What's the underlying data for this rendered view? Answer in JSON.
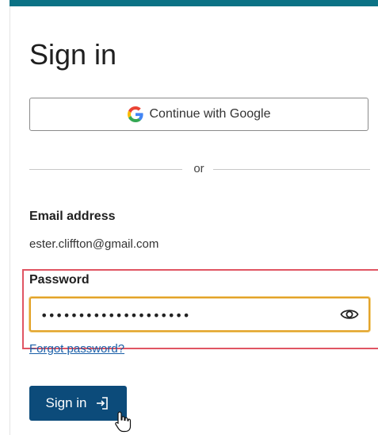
{
  "form": {
    "title": "Sign in",
    "google_button_label": "Continue with Google",
    "divider_text": "or",
    "email_label": "Email address",
    "email_value": "ester.cliffton@gmail.com",
    "password_label": "Password",
    "password_value": "••••••••••••••••••••",
    "forgot_password_label": "Forgot password?",
    "submit_label": "Sign in"
  },
  "icons": {
    "google": "google-logo-icon",
    "show_password": "eye-icon",
    "submit": "sign-in-arrow-icon",
    "cursor": "hand-pointer-cursor-icon"
  },
  "colors": {
    "top_bar": "#0b7285",
    "primary_button": "#0c4b7a",
    "link": "#1a5fa8",
    "focus_border": "#e3a42b",
    "highlight_border": "#e05563"
  }
}
